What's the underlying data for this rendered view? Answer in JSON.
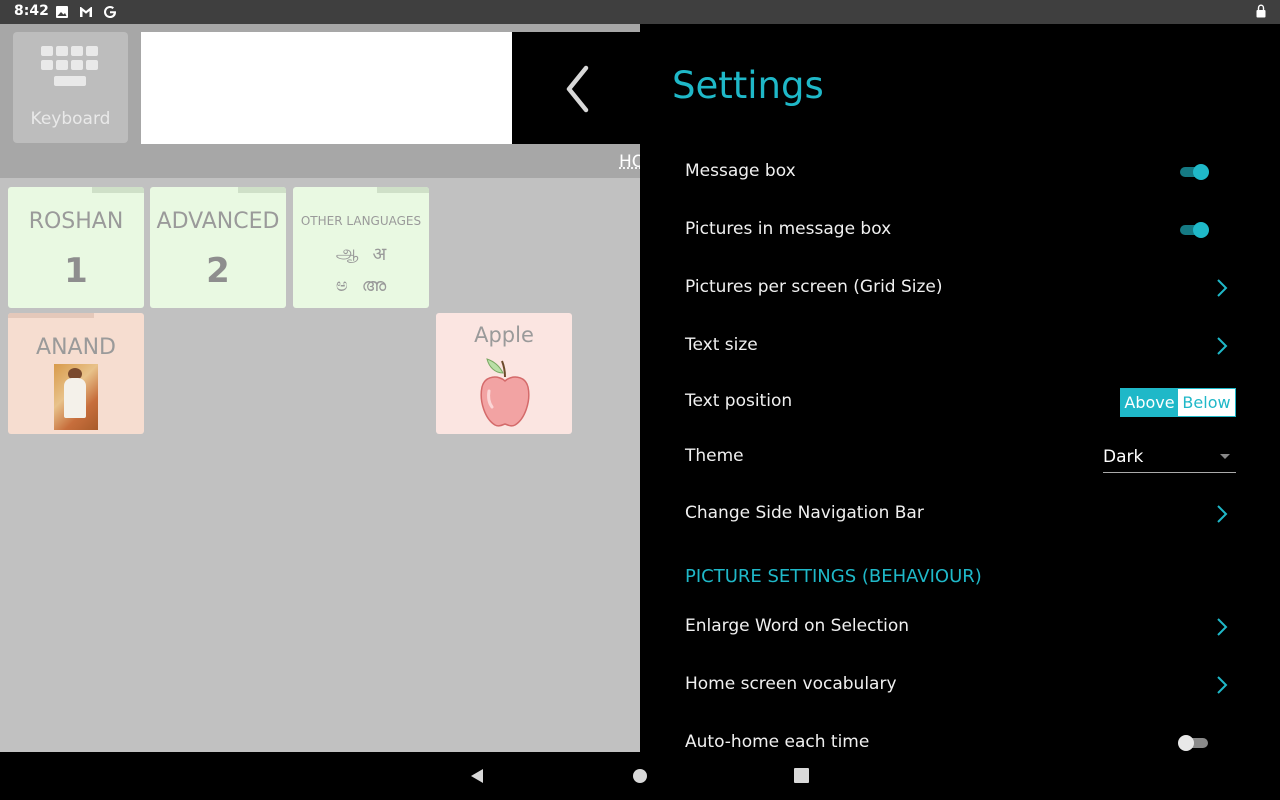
{
  "status_bar": {
    "time": "8:42",
    "icons": [
      "image-icon",
      "gmail-icon",
      "google-icon",
      "lock-icon"
    ]
  },
  "app": {
    "keyboard_label": "Keyboard",
    "home_link": "HO",
    "tiles": [
      {
        "title": "ROSHAN",
        "number": "1"
      },
      {
        "title": "ADVANCED",
        "number": "2"
      },
      {
        "title": "OTHER LANGUAGES",
        "scripts": [
          "ஆ",
          "अ",
          "ಅ",
          "അ"
        ]
      },
      {
        "title": "ANAND"
      },
      {
        "title": "Apple"
      }
    ]
  },
  "settings": {
    "title": "Settings",
    "message_box": {
      "label": "Message box",
      "on": true
    },
    "pictures_in_message_box": {
      "label": "Pictures in message box",
      "on": true
    },
    "grid_size": {
      "label": "Pictures per screen (Grid Size)"
    },
    "text_size": {
      "label": "Text size"
    },
    "text_position": {
      "label": "Text position",
      "options": [
        "Above",
        "Below"
      ],
      "selected": "Above"
    },
    "theme": {
      "label": "Theme",
      "value": "Dark"
    },
    "side_nav": {
      "label": "Change Side Navigation Bar"
    },
    "section_picture": "PICTURE SETTINGS (BEHAVIOUR)",
    "enlarge_word": {
      "label": "Enlarge Word on Selection"
    },
    "home_vocab": {
      "label": "Home screen vocabulary"
    },
    "auto_home": {
      "label": "Auto-home each time",
      "on": false
    }
  },
  "colors": {
    "accent": "#1fb8c8",
    "settings_bg": "#000000",
    "app_bg": "#c1c1c1"
  }
}
